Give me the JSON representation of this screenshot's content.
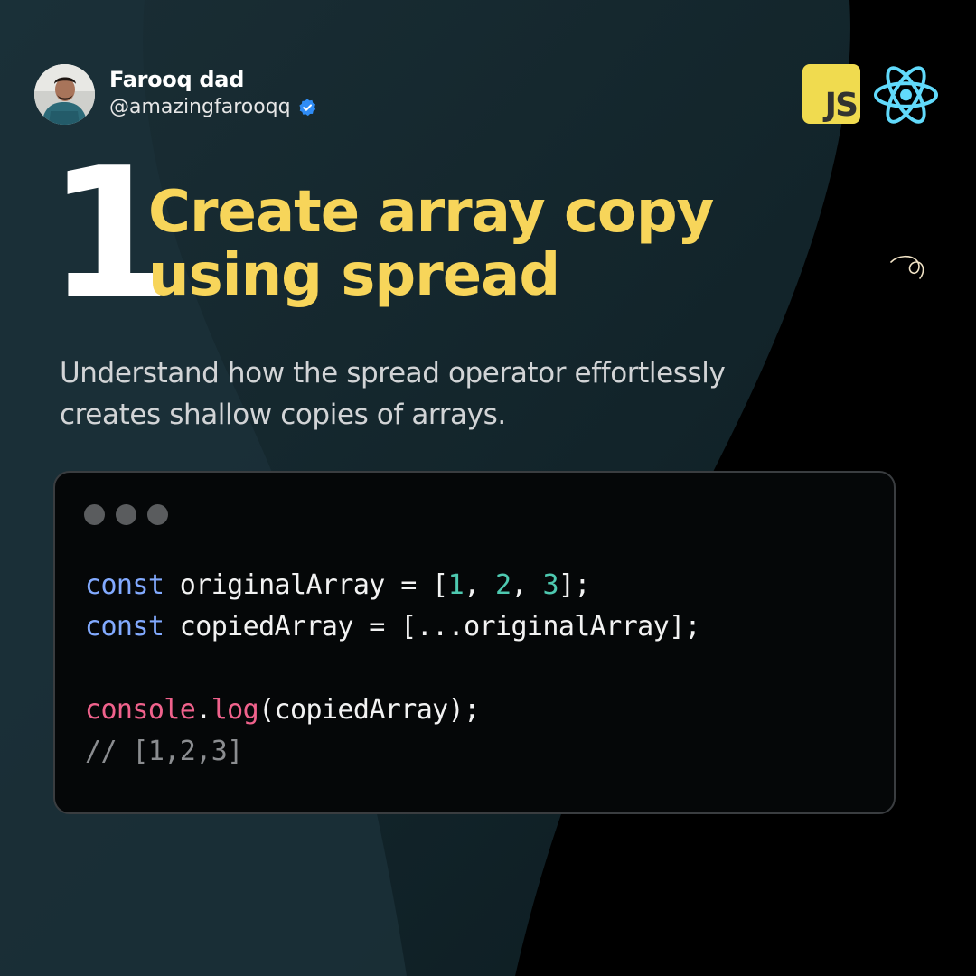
{
  "author": {
    "name": "Farooq dad",
    "handle": "@amazingfarooqq",
    "verified_icon": "verified-badge-icon"
  },
  "badges": {
    "js_label": "JS",
    "react_icon": "react-atom-icon"
  },
  "slide": {
    "number": "1",
    "title_line1": "Create array copy",
    "title_line2": "using spread",
    "subtitle_line1": "Understand how the spread operator effortlessly",
    "subtitle_line2": "creates shallow copies of arrays."
  },
  "code": {
    "kw1": "const",
    "var1": " originalArray = [",
    "n1": "1",
    "sep1": ", ",
    "n2": "2",
    "sep2": ", ",
    "n3": "3",
    "end1": "];",
    "kw2": "const",
    "line2_rest": " copiedArray = [...originalArray];",
    "obj": "console",
    "dot": ".",
    "method": "log",
    "call_rest": "(copiedArray);",
    "comment": "// [1,2,3]"
  },
  "colors": {
    "title": "#f7d55a",
    "background": "#000000",
    "panel": "#14262c",
    "keyword": "#82aaff",
    "number": "#4ec9b0",
    "function": "#f0628c",
    "comment": "#8b8d90",
    "js_yellow": "#f0db4f",
    "react_cyan": "#61dafb"
  }
}
